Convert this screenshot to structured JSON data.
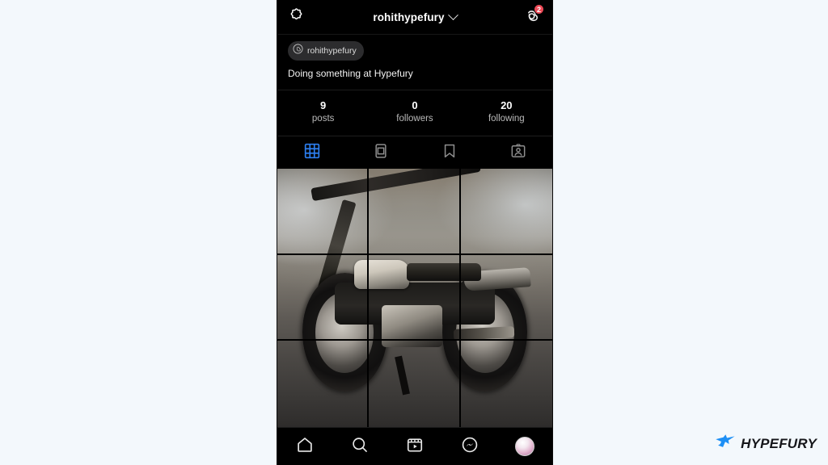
{
  "background_color": "#f3f8fc",
  "phone": {
    "background_color": "#000000",
    "topbar": {
      "left_icon": "threads-app-icon",
      "username": "rohithypefury",
      "chevron_icon": "chevron-down-icon",
      "right_icon": "threads-logo-icon",
      "notification_count": "2",
      "badge_color": "#ed4956"
    },
    "bio": {
      "threads_pill": {
        "icon": "threads-logo-icon",
        "label": "rohithypefury"
      },
      "text": "Doing something at Hypefury"
    },
    "stats": [
      {
        "value": "9",
        "label": "posts"
      },
      {
        "value": "0",
        "label": "followers"
      },
      {
        "value": "20",
        "label": "following"
      }
    ],
    "tabs": [
      {
        "icon": "grid-icon",
        "name": "tab-posts",
        "active": true
      },
      {
        "icon": "reels-icon",
        "name": "tab-reels",
        "active": false
      },
      {
        "icon": "bookmark-icon",
        "name": "tab-saved",
        "active": false
      },
      {
        "icon": "tagged-icon",
        "name": "tab-tagged",
        "active": false
      }
    ],
    "tab_active_color": "#2d7ff0",
    "tab_inactive_color": "#8e8e8e",
    "grid": {
      "description": "motorcycle-photo-split-into-nine-tiles",
      "columns": 3,
      "rows": 3,
      "cells": 9
    },
    "bottom_nav": [
      {
        "icon": "home-icon",
        "name": "nav-home"
      },
      {
        "icon": "search-icon",
        "name": "nav-search"
      },
      {
        "icon": "reels-icon",
        "name": "nav-reels"
      },
      {
        "icon": "messenger-icon",
        "name": "nav-messages"
      },
      {
        "icon": "avatar-icon",
        "name": "nav-profile"
      }
    ]
  },
  "watermark": {
    "logo_icon": "hypefury-bird-icon",
    "logo_color": "#1d8ff5",
    "text": "HYPEFURY",
    "text_color": "#15161a"
  }
}
